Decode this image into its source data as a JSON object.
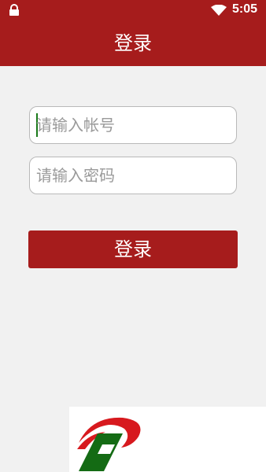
{
  "status_bar": {
    "time": "5:05",
    "icons": [
      "lock-icon",
      "wifi-icon"
    ]
  },
  "app_bar": {
    "title": "登录"
  },
  "form": {
    "account": {
      "placeholder": "请输入帐号",
      "value": ""
    },
    "password": {
      "placeholder": "请输入密码",
      "value": ""
    },
    "login_label": "登录"
  },
  "logo": {
    "icon": "brand-logo-icon"
  },
  "colors": {
    "primary": "#a61c1c",
    "background": "#f1f1f1",
    "logo_red": "#d7191e",
    "logo_green": "#146b14",
    "caret": "#1a7a1a"
  }
}
